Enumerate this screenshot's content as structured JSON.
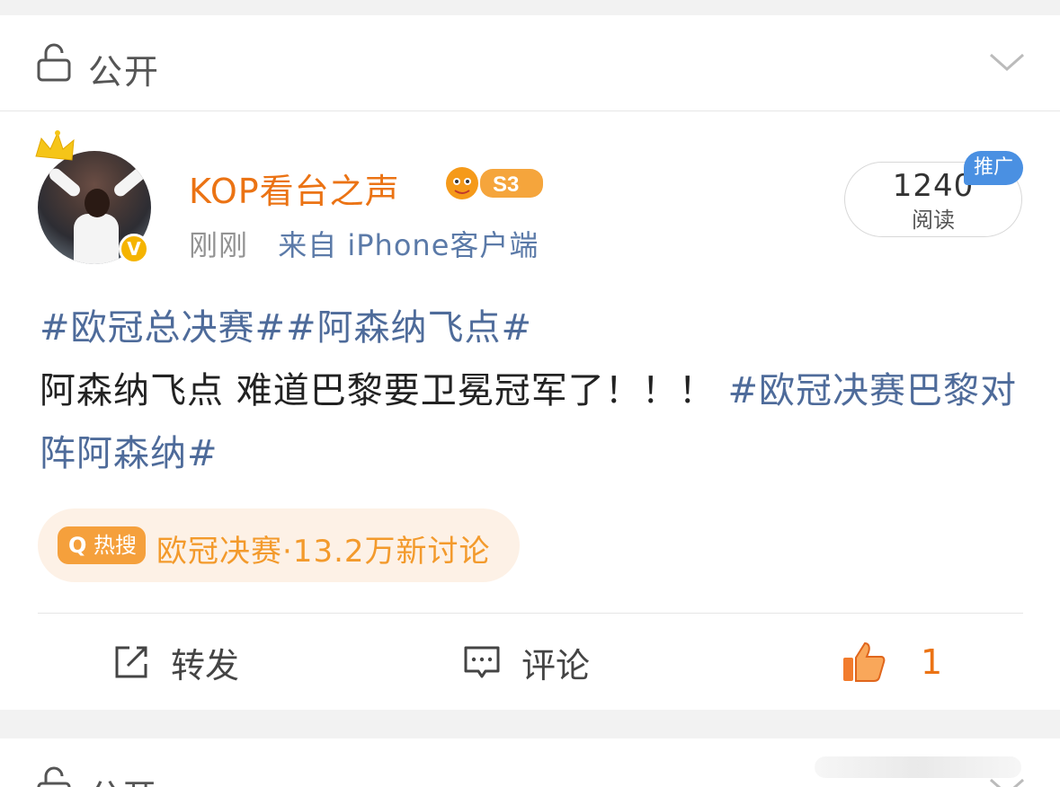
{
  "visibility": {
    "label": "公开"
  },
  "post": {
    "username": "KOP看台之声",
    "level_badge": "S3",
    "verified_mark": "V",
    "time": "刚刚",
    "client": "来自 iPhone客户端",
    "reads": {
      "count": "1240",
      "label": "阅读"
    },
    "promo_tag": "推广",
    "content": {
      "hashtag1": "#欧冠总决赛#",
      "hashtag2": "#阿森纳飞点#",
      "body": "阿森纳飞点 难道巴黎要卫冕冠军了！！！",
      "hashtag3": "#欧冠决赛巴黎对阵阿森纳#"
    },
    "hot_search": {
      "icon_label": "热搜",
      "text": "欧冠决赛·13.2万新讨论"
    },
    "actions": {
      "repost_label": "转发",
      "comment_label": "评论",
      "like_count": "1"
    }
  },
  "next_card": {
    "visibility_label": "公开"
  },
  "colors": {
    "username": "#eb7314",
    "hashtag": "#4e6b9a",
    "hot_search": "#f39a2c",
    "promo_tag": "#4a90e2",
    "like": "#eb7314"
  }
}
